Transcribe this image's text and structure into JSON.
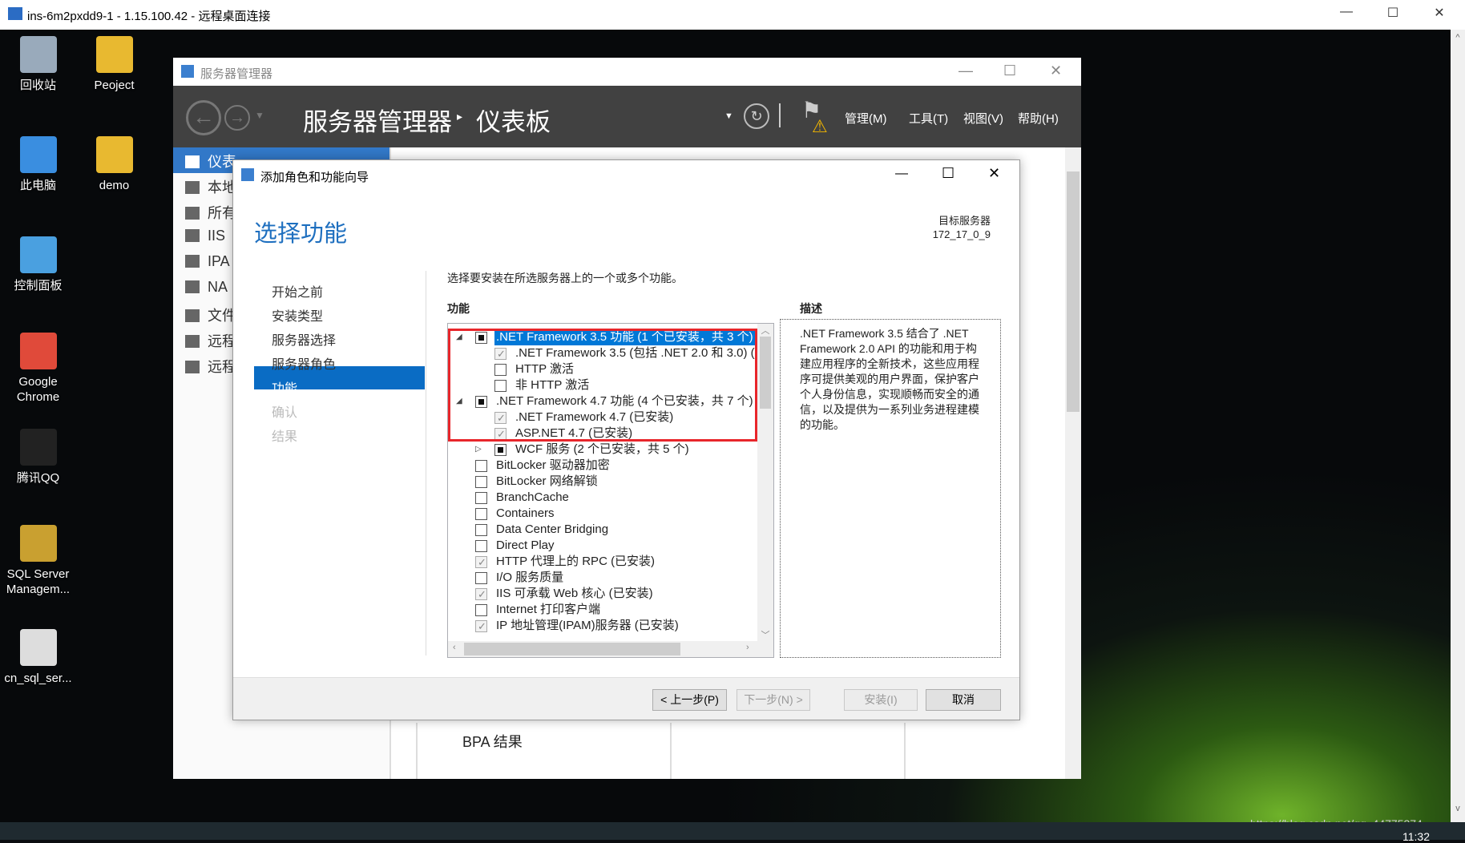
{
  "rdp": {
    "title": "ins-6m2pxdd9-1 - 1.15.100.42 - 远程桌面连接"
  },
  "desktop": {
    "icons": [
      "回收站",
      "Peoject",
      "此电脑",
      "demo",
      "控制面板",
      "Google Chrome",
      "腾讯QQ",
      "SQL Server Managem...",
      "cn_sql_ser..."
    ],
    "watermark": "https://blog.csdn.net/qq_44775374",
    "clock": "11:32"
  },
  "server_manager": {
    "title": "服务器管理器",
    "breadcrumb_root": "服务器管理器",
    "breadcrumb_page": "仪表板",
    "menu": [
      "管理(M)",
      "工具(T)",
      "视图(V)",
      "帮助(H)"
    ],
    "sidebar": [
      "仪表",
      "本地",
      "所有",
      "IIS",
      "IPA",
      "NA",
      "文件",
      "远程",
      "远程"
    ],
    "bpa": "BPA 结果"
  },
  "wizard": {
    "title": "添加角色和功能向导",
    "heading": "选择功能",
    "target_label": "目标服务器",
    "target_value": "172_17_0_9",
    "nav": [
      "开始之前",
      "安装类型",
      "服务器选择",
      "服务器角色",
      "功能",
      "确认",
      "结果"
    ],
    "nav_selected": 4,
    "instruction": "选择要安装在所选服务器上的一个或多个功能。",
    "features_label": "功能",
    "description_label": "描述",
    "description": ".NET Framework 3.5 结合了 .NET Framework 2.0 API 的功能和用于构建应用程序的全新技术，这些应用程序可提供美观的用户界面，保护客户个人身份信息，实现顺畅而安全的通信，以及提供为一系列业务进程建模的功能。",
    "features": [
      {
        "label": ".NET Framework 3.5 功能 (1 个已安装，共 3 个)",
        "level": 0,
        "state": "partial",
        "expander": "expanded",
        "selected": true
      },
      {
        "label": ".NET Framework 3.5 (包括 .NET 2.0 和 3.0) (",
        "level": 1,
        "state": "checked"
      },
      {
        "label": "HTTP 激活",
        "level": 1,
        "state": "unchecked"
      },
      {
        "label": "非 HTTP 激活",
        "level": 1,
        "state": "unchecked"
      },
      {
        "label": ".NET Framework 4.7 功能 (4 个已安装，共 7 个)",
        "level": 0,
        "state": "partial",
        "expander": "expanded"
      },
      {
        "label": ".NET Framework 4.7 (已安装)",
        "level": 1,
        "state": "checked"
      },
      {
        "label": "ASP.NET 4.7 (已安装)",
        "level": 1,
        "state": "checked"
      },
      {
        "label": "WCF 服务 (2 个已安装，共 5 个)",
        "level": 1,
        "state": "partial",
        "expander": "collapsed"
      },
      {
        "label": "BitLocker 驱动器加密",
        "level": 0,
        "state": "unchecked"
      },
      {
        "label": "BitLocker 网络解锁",
        "level": 0,
        "state": "unchecked"
      },
      {
        "label": "BranchCache",
        "level": 0,
        "state": "unchecked"
      },
      {
        "label": "Containers",
        "level": 0,
        "state": "unchecked"
      },
      {
        "label": "Data Center Bridging",
        "level": 0,
        "state": "unchecked"
      },
      {
        "label": "Direct Play",
        "level": 0,
        "state": "unchecked"
      },
      {
        "label": "HTTP 代理上的 RPC (已安装)",
        "level": 0,
        "state": "checked"
      },
      {
        "label": "I/O 服务质量",
        "level": 0,
        "state": "unchecked"
      },
      {
        "label": "IIS 可承载 Web 核心 (已安装)",
        "level": 0,
        "state": "checked"
      },
      {
        "label": "Internet 打印客户端",
        "level": 0,
        "state": "unchecked"
      },
      {
        "label": "IP 地址管理(IPAM)服务器 (已安装)",
        "level": 0,
        "state": "checked"
      }
    ],
    "buttons": {
      "prev": "< 上一步(P)",
      "next": "下一步(N) >",
      "install": "安装(I)",
      "cancel": "取消"
    },
    "highlight_color": "#e8262b",
    "selection_color": "#0078d7"
  }
}
